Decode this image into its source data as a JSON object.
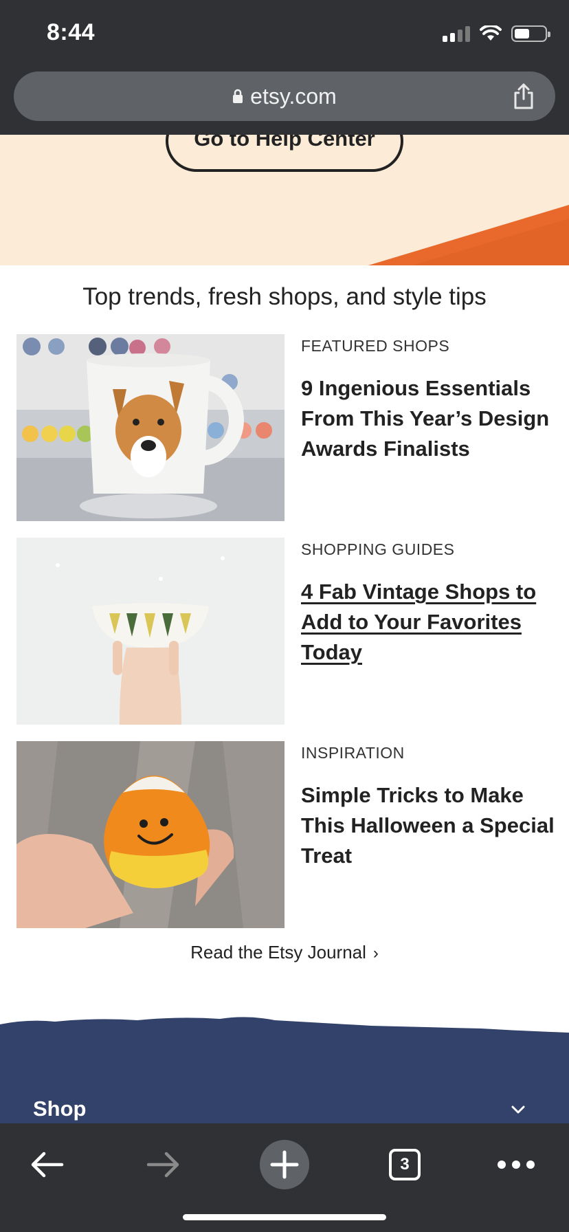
{
  "status_bar": {
    "time": "8:44"
  },
  "browser": {
    "url": "etsy.com"
  },
  "help": {
    "button_label": "Go to Help Center"
  },
  "section": {
    "title": "Top trends, fresh shops, and style tips"
  },
  "articles": [
    {
      "category": "FEATURED SHOPS",
      "title": "9 Ingenious Essentials From This Year’s Design Awards Finalists"
    },
    {
      "category": "SHOPPING GUIDES",
      "title": "4 Fab Vintage Shops to Add to Your Favorites Today"
    },
    {
      "category": "INSPIRATION",
      "title": "Simple Tricks to Make This Halloween a Special Treat"
    }
  ],
  "journal_link": "Read the Etsy Journal",
  "footer": {
    "shop_label": "Shop"
  },
  "toolbar": {
    "tab_count": "3"
  },
  "colors": {
    "chrome": "#303134",
    "banner": "#fbebd7",
    "accent_orange": "#e9692c",
    "footer_navy": "#33426b"
  }
}
